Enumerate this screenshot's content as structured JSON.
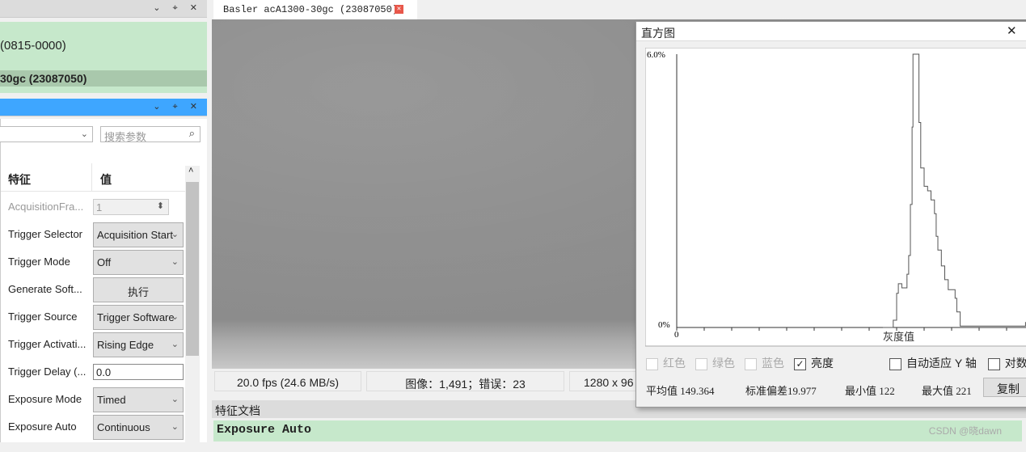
{
  "devices_panel": {
    "device_partial": "(0815-0000)",
    "camera_partial": "30gc (23087050)"
  },
  "features_panel": {
    "search_placeholder": "搜索参数",
    "col_feature": "特征",
    "col_value": "值",
    "rows": [
      {
        "label": "AcquisitionFra...",
        "value": "1",
        "type": "spin",
        "disabled": true
      },
      {
        "label": "Trigger Selector",
        "value": "Acquisition Start",
        "type": "select"
      },
      {
        "label": "Trigger Mode",
        "value": "Off",
        "type": "select"
      },
      {
        "label": "Generate Soft...",
        "value": "执行",
        "type": "button"
      },
      {
        "label": "Trigger Source",
        "value": "Trigger Software",
        "type": "select"
      },
      {
        "label": "Trigger Activati...",
        "value": "Rising Edge",
        "type": "select"
      },
      {
        "label": "Trigger Delay (...",
        "value": "0.0",
        "type": "text"
      },
      {
        "label": "Exposure Mode",
        "value": "Timed",
        "type": "select"
      },
      {
        "label": "Exposure Auto",
        "value": "Continuous",
        "type": "select"
      }
    ]
  },
  "tab": {
    "title": "Basler acA1300-30gc (23087050)"
  },
  "status": {
    "fps": "20.0 fps (24.6 MB/s)",
    "images": "图像：1,491；错误：23",
    "resolution": "1280 x 96"
  },
  "doc_panel": {
    "title": "特征文档",
    "content": "Exposure Auto"
  },
  "histogram": {
    "title": "直方图",
    "channels": [
      {
        "label": "红色",
        "checked": false,
        "enabled": false
      },
      {
        "label": "绿色",
        "checked": false,
        "enabled": false
      },
      {
        "label": "蓝色",
        "checked": false,
        "enabled": false
      },
      {
        "label": "亮度",
        "checked": true,
        "enabled": true
      }
    ],
    "auto_y": "自动适应 Y 轴",
    "log": "对数",
    "stats": {
      "mean": "平均值 149.364",
      "std": "标准偏差19.977",
      "min": "最小值 122",
      "max": "最大值 221"
    },
    "copy": "复制"
  },
  "chart_data": {
    "type": "line",
    "xlabel": "灰度值",
    "ylabel": "",
    "ytick_labels": [
      "6.0%",
      "0%"
    ],
    "xtick_label": "0",
    "ylim": [
      0,
      6.0
    ],
    "xlim_visible": [
      0,
      203
    ],
    "series": [
      {
        "color": "#555555",
        "points": [
          [
            120,
            0
          ],
          [
            124,
            0
          ],
          [
            126,
            0.16
          ],
          [
            128,
            0.75
          ],
          [
            129,
            0.96
          ],
          [
            131,
            0.87
          ],
          [
            134,
            1.17
          ],
          [
            135,
            1.58
          ],
          [
            136,
            2.7
          ],
          [
            137,
            4.4
          ],
          [
            137.5,
            7
          ],
          [
            140,
            7
          ],
          [
            141,
            4.5
          ],
          [
            142,
            3.5
          ],
          [
            144,
            3.1
          ],
          [
            146,
            3.0
          ],
          [
            148,
            2.8
          ],
          [
            150,
            2.5
          ],
          [
            151,
            2.0
          ],
          [
            152,
            1.7
          ],
          [
            154,
            1.35
          ],
          [
            156,
            1.05
          ],
          [
            158,
            0.83
          ],
          [
            160,
            0.83
          ],
          [
            162,
            0.64
          ],
          [
            163,
            0.34
          ],
          [
            165,
            0.03
          ],
          [
            200,
            0.03
          ],
          [
            203,
            0.12
          ]
        ]
      }
    ]
  },
  "watermark": "CSDN @晓dawn"
}
